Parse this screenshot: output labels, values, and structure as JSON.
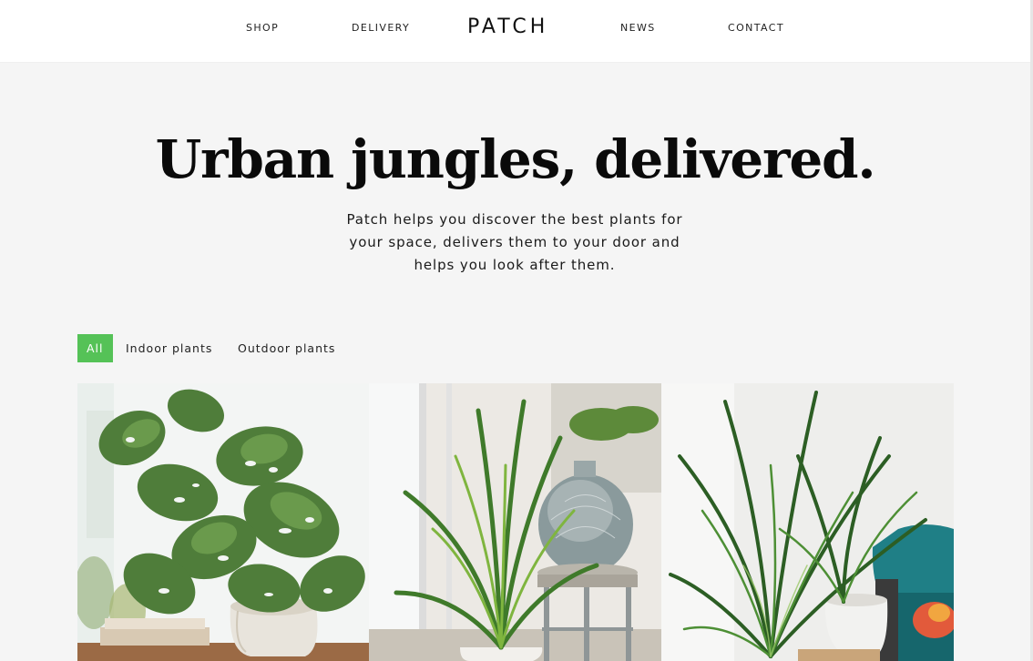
{
  "nav": {
    "items": [
      {
        "label": "SHOP"
      },
      {
        "label": "DELIVERY"
      },
      {
        "label": "NEWS"
      },
      {
        "label": "CONTACT"
      }
    ],
    "logo": "PATCH"
  },
  "hero": {
    "title": "Urban jungles, delivered.",
    "subtitle_lines": [
      "Patch helps you discover the best plants for",
      "your space, delivers them to your door and",
      "helps you look after them."
    ]
  },
  "filters": {
    "items": [
      {
        "label": "All",
        "active": true
      },
      {
        "label": "Indoor plants",
        "active": false
      },
      {
        "label": "Outdoor plants",
        "active": false
      }
    ]
  },
  "products": [
    {
      "image": "monstera-adansonii-plant-photo"
    },
    {
      "image": "areca-palm-plant-photo"
    },
    {
      "image": "kentia-palm-plant-photo"
    }
  ],
  "colors": {
    "accent": "#55c257",
    "background": "#f5f5f5",
    "header": "#ffffff"
  }
}
